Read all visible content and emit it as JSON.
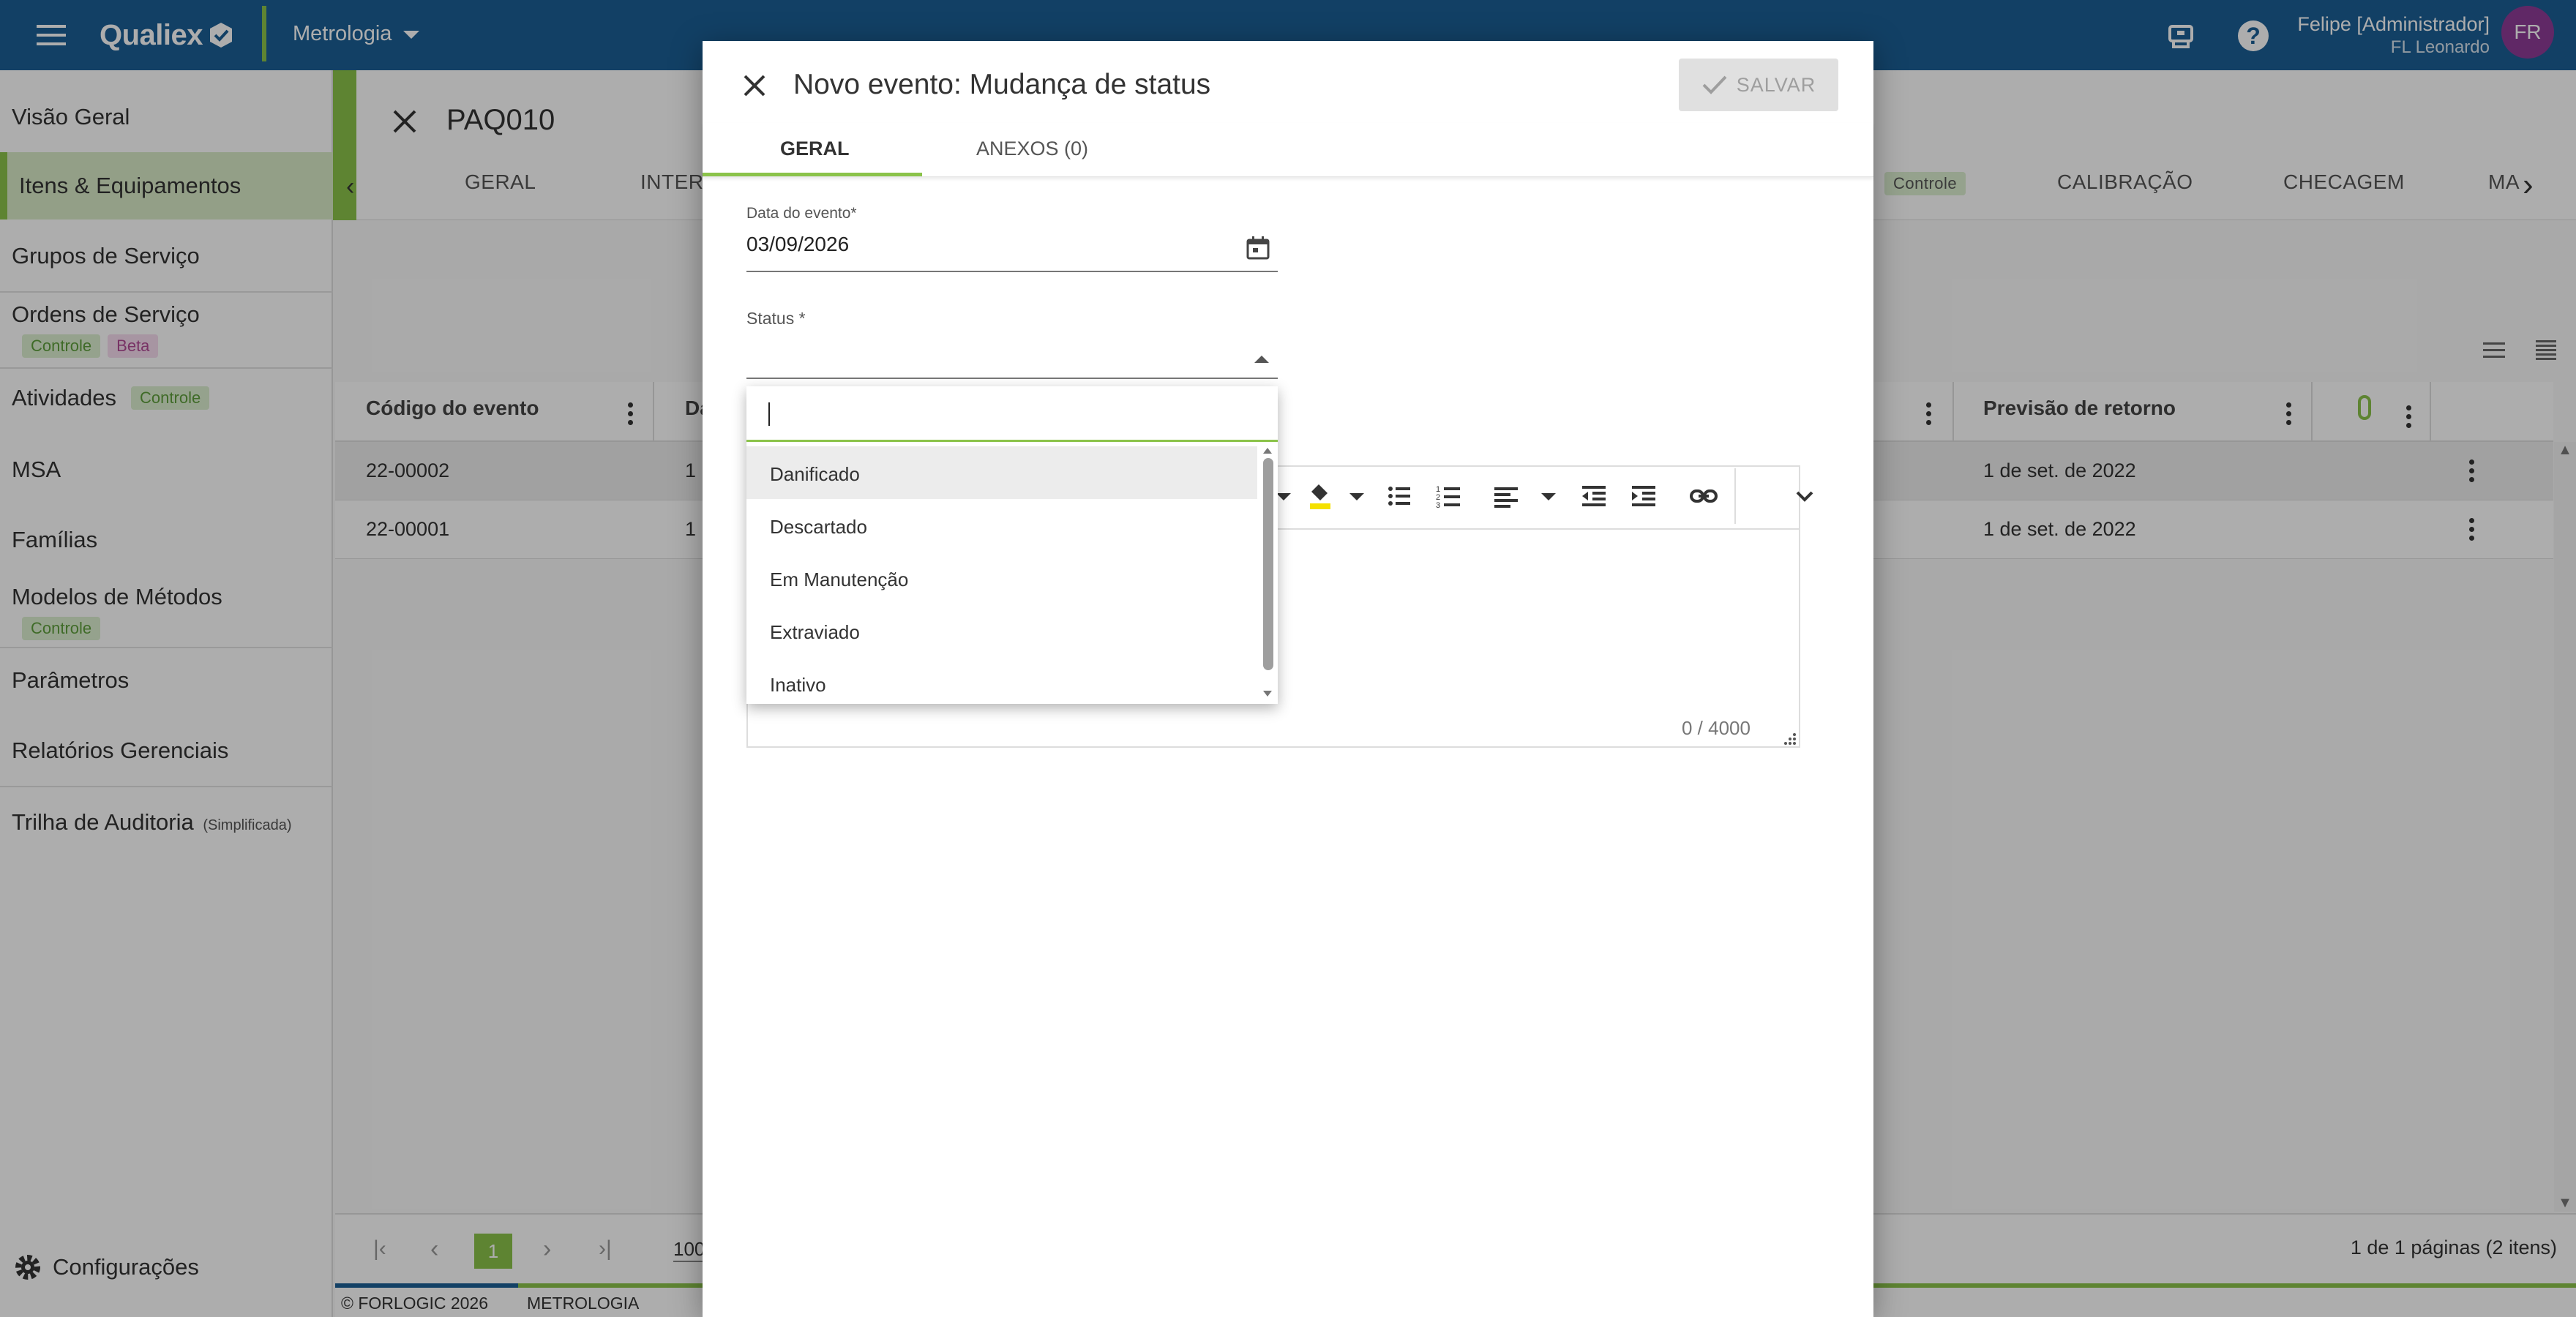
{
  "topbar": {
    "brand": "Qualiex",
    "module": "Metrologia",
    "user_name": "Felipe [Administrador]",
    "user_org": "FL Leonardo",
    "avatar_initials": "FR"
  },
  "sidebar": {
    "items": [
      {
        "label": "Visão Geral"
      },
      {
        "label": "Itens & Equipamentos"
      },
      {
        "label": "Grupos de Serviço"
      },
      {
        "label": "Ordens de Serviço",
        "badges": [
          "Controle",
          "Beta"
        ]
      },
      {
        "label": "Atividades",
        "badges": [
          "Controle"
        ]
      },
      {
        "label": "MSA"
      },
      {
        "label": "Famílias"
      },
      {
        "label": "Modelos de Métodos",
        "badges": [
          "Controle"
        ]
      },
      {
        "label": "Parâmetros"
      },
      {
        "label": "Relatórios Gerenciais"
      },
      {
        "label": "Trilha de Auditoria",
        "suffix": "(Simplificada)"
      }
    ],
    "settings_label": "Configurações"
  },
  "page": {
    "title": "PAQ010",
    "tabs": [
      "GERAL",
      "INTER",
      "Controle",
      "CALIBRAÇÃO",
      "CHECAGEM",
      "MA"
    ]
  },
  "table": {
    "headers": [
      "Código do evento",
      "Da",
      "Previsão de retorno"
    ],
    "rows": [
      {
        "code": "22-00002",
        "date_partial": "1",
        "return": "1 de set. de 2022"
      },
      {
        "code": "22-00001",
        "date_partial": "1",
        "return": "1 de set. de 2022"
      }
    ],
    "pagination": {
      "current_page": "1",
      "page_size": "100",
      "summary": "1 de 1 páginas (2 itens)"
    }
  },
  "footer": {
    "copyright": "© FORLOGIC 2026",
    "module": "METROLOGIA"
  },
  "modal": {
    "title": "Novo evento: Mudança de status",
    "save_label": "SALVAR",
    "tabs": [
      "GERAL",
      "ANEXOS (0)"
    ],
    "event_date_label": "Data do evento*",
    "event_date_value": "03/09/2026",
    "status_label": "Status *",
    "char_counter": "0 / 4000"
  },
  "dropdown": {
    "search_value": "",
    "options": [
      "Danificado",
      "Descartado",
      "Em Manutenção",
      "Extraviado",
      "Inativo"
    ],
    "highlighted_index": 0
  },
  "colors": {
    "topbar": "#1b5f96",
    "accent_green": "#8bc34a",
    "avatar": "#8e3b97",
    "active_nav": "#d9ebc8"
  }
}
